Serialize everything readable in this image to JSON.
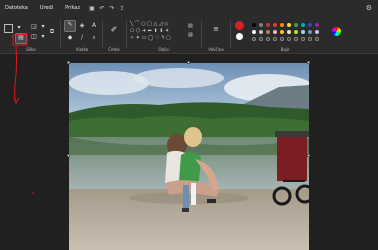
{
  "menu": {
    "file": "Datoteka",
    "edit": "Uredi",
    "view": "Prikaz"
  },
  "ribbon": {
    "groups": {
      "image": "Slike",
      "tools": "Alatke",
      "brushes": "Četke",
      "shapes": "Oblici",
      "size": "Veličina",
      "colors": "Boje"
    }
  },
  "colors": {
    "primary": "#e02020",
    "secondary": "#ffffff",
    "palette_row1": [
      "#000000",
      "#7f7f7f",
      "#c0392b",
      "#e53935",
      "#fb8c00",
      "#fdd835",
      "#43a047",
      "#00acc1",
      "#3949ab",
      "#8e24aa"
    ],
    "palette_row2": [
      "#ffffff",
      "#c3c3c3",
      "#b97a57",
      "#ffaec9",
      "#ffc90e",
      "#efe4b0",
      "#b5e61d",
      "#99d9ea",
      "#7092be",
      "#c8bfe7"
    ],
    "annotation": "#e0181f"
  },
  "icons": {
    "save": "save-icon",
    "undo": "undo-icon",
    "redo": "redo-icon",
    "share": "share-icon",
    "settings": "gear-icon",
    "select": "select-icon",
    "crop": "crop-icon",
    "resize": "resize-icon",
    "rotate": "rotate-icon",
    "pencil": "pencil-icon",
    "fill": "fill-icon",
    "text": "text-icon",
    "eraser": "eraser-icon",
    "picker": "color-picker-icon",
    "magnifier": "magnifier-icon",
    "brush": "brush-icon",
    "color_wheel": "color-wheel-icon"
  }
}
